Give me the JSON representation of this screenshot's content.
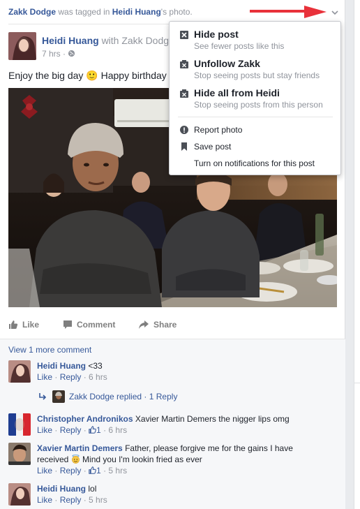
{
  "story": {
    "actor": "Zakk Dodge",
    "verb": "was tagged in",
    "owner": "Heidi Huang",
    "suffix": "'s photo."
  },
  "post": {
    "author": "Heidi Huang",
    "with_text": "with Zakk Dodge",
    "time": "7 hrs",
    "text": "Enjoy the big day 🙂 Happy birthday"
  },
  "actions": {
    "like": "Like",
    "comment": "Comment",
    "share": "Share"
  },
  "menu": {
    "hide_post": {
      "title": "Hide post",
      "sub": "See fewer posts like this"
    },
    "unfollow": {
      "title": "Unfollow Zakk",
      "sub": "Stop seeing posts but stay friends"
    },
    "hide_all": {
      "title": "Hide all from Heidi",
      "sub": "Stop seeing posts from this person"
    },
    "report": "Report photo",
    "save": "Save post",
    "notify": "Turn on notifications for this post"
  },
  "comments": {
    "view_more": "View 1 more comment",
    "items": [
      {
        "name": "Heidi Huang",
        "text": "<33",
        "like": "Like",
        "reply": "Reply",
        "time": "6 hrs"
      },
      {
        "name": "Christopher Andronikos",
        "text": "Xavier Martin Demers the nigger lips omg",
        "like": "Like",
        "reply": "Reply",
        "likes": "1",
        "time": "6 hrs"
      },
      {
        "name": "Xavier Martin Demers",
        "text": "Father, please forgive me for the gains I have",
        "text2a": "received",
        "text2b": "Mind you I'm lookin fried as ever",
        "like": "Like",
        "reply": "Reply",
        "likes": "1",
        "time": "5 hrs"
      },
      {
        "name": "Heidi Huang",
        "text": "lol",
        "like": "Like",
        "reply": "Reply",
        "time": "5 hrs"
      }
    ],
    "reply_line": {
      "name": "Zakk Dodge",
      "text": "replied",
      "count": "1 Reply"
    }
  },
  "colors": {
    "link": "#365899",
    "muted": "#90949c",
    "arrow": "#e8313a"
  }
}
